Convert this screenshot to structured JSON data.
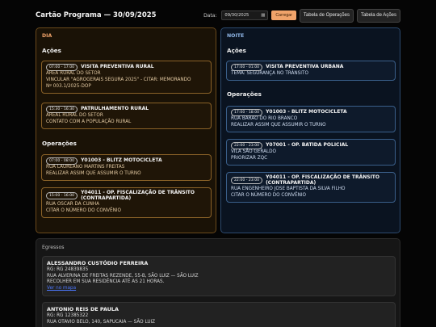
{
  "header": {
    "title": "Cartão Programa — 30/09/2025",
    "date_label": "Data:",
    "date_value": "09/30/2025",
    "calendar_icon": "calendar-icon",
    "load_button": "Carregar",
    "operations_table_button": "Tabela de Operações",
    "actions_table_button": "Tabela de Ações"
  },
  "day": {
    "label": "DIA",
    "actions_title": "Ações",
    "actions": [
      {
        "time": "07:00 - 17:00",
        "title": "VISITA PREVENTIVA RURAL",
        "lines": [
          "AREA RURAL DO SETOR",
          "VINCULAR \"AGROGERAIS SEGURA 2025\" - CITAR: MEMORANDO",
          "Nº 003.1/2025-DOP"
        ]
      },
      {
        "time": "15:30 - 16:30",
        "title": "PATRULHAMENTO RURAL",
        "lines": [
          "AREAL RURAL DO SETOR",
          "CONTATO COM A POPULAÇÃO RURAL"
        ]
      }
    ],
    "operations_title": "Operações",
    "operations": [
      {
        "time": "07:00 - 08:00",
        "title": "Y01003 - BLITZ MOTOCICLETA",
        "lines": [
          "RUA LAUREANO MARTINS FREITAS",
          "REALIZAR ASSIM QUE ASSUMIR O TURNO"
        ]
      },
      {
        "time": "15:00 - 16:00",
        "title": "Y04011 - OP. FISCALIZAÇÃO DE TRÂNSITO (CONTRAPARTIDA)",
        "lines": [
          "RUA OSCAR DA CUNHA",
          "CITAR O NÚMERO DO CONVÊNIO"
        ]
      }
    ]
  },
  "night": {
    "label": "NOITE",
    "actions_title": "Ações",
    "actions": [
      {
        "time": "17:00 - 01:00",
        "title": "VISITA PREVENTIVA URBANA",
        "lines": [
          "TEMA: SEGURANÇA NO TRÂNSITO"
        ]
      }
    ],
    "operations_title": "Operações",
    "operations": [
      {
        "time": "17:00 - 18:00",
        "title": "Y01003 - BLITZ MOTOCICLETA",
        "lines": [
          "RUA BARAO DO RIO BRANCO",
          "REALIZAR ASSIM QUE ASSUMIR O TURNO"
        ]
      },
      {
        "time": "22:00 - 23:00",
        "title": "Y07001 - OP. BATIDA POLICIAL",
        "lines": [
          "VILA SÃO GERALDO",
          "PRIORIZAR ZQC"
        ]
      },
      {
        "time": "22:00 - 23:00",
        "title": "Y04011 - OP. FISCALIZAÇÃO DE TRÂNSITO (CONTRAPARTIDA)",
        "lines": [
          "RUA ENGENHEIRO JOSE BAPTISTA DA SILVA FILHO",
          "CITAR O NÚMERO DO CONVÊNIO"
        ]
      }
    ]
  },
  "egressos": {
    "title": "Egressos",
    "items": [
      {
        "name": "ALESSANDRO CUSTÓDIO FERREIRA",
        "lines": [
          "RG: RG 24839835",
          "RUA ALVERINA DE FREITAS REZENDE, 55-B, SÃO LUIZ — SÃO LUIZ",
          "RECOLHER EM SUA RESIDÊNCIA ATÉ AS 21 HORAS."
        ],
        "link": "Ver no mapa"
      },
      {
        "name": "ANTONIO REIS DE PAULA",
        "lines": [
          "RG: RG 12385322",
          "RUA OTAVIO BELO, 140, SAPUCAIA — SÃO LUIZ"
        ],
        "link": ""
      }
    ]
  }
}
